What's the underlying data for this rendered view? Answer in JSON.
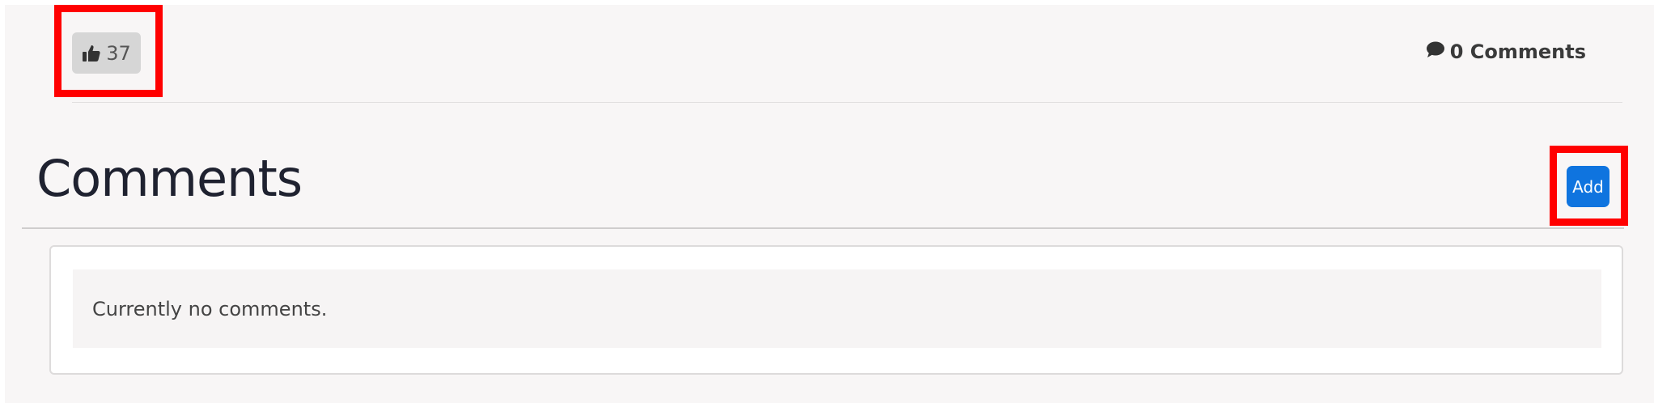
{
  "likes": {
    "count": "37",
    "icon": "thumbs-up-icon"
  },
  "comments_link": {
    "icon": "comment-bubble-icon",
    "label": "0 Comments"
  },
  "comments_section": {
    "title": "Comments",
    "add_label": "Add",
    "empty_message": "Currently no comments."
  },
  "colors": {
    "accent": "#0f74df",
    "highlight": "#ff0000",
    "like_button_bg": "#d6d6d6",
    "panel_bg": "#f8f6f6"
  }
}
